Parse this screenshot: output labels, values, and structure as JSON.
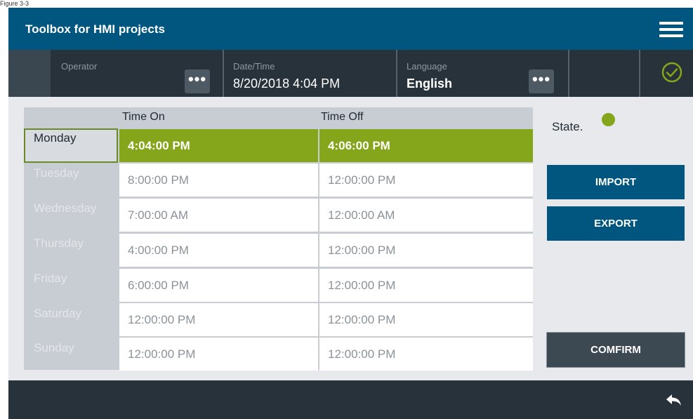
{
  "figure_label": "Figure 3-3",
  "header": {
    "title": "Toolbox for HMI projects",
    "menu_icon": "hamburger-menu-icon"
  },
  "infobar": {
    "operator_label": "Operator",
    "datetime_label": "Date/Time",
    "datetime_value": "8/20/2018 4:04 PM",
    "language_label": "Language",
    "language_value": "English",
    "dots_glyph": "•••",
    "status_icon": "check-circle-icon",
    "status_color": "#85a51b"
  },
  "table": {
    "headers": {
      "time_on": "Time On",
      "time_off": "Time Off"
    },
    "rows": [
      {
        "day": "Monday",
        "on": "4:04:00 PM",
        "off": "4:06:00 PM",
        "selected": true
      },
      {
        "day": "Tuesday",
        "on": "8:00:00 PM",
        "off": "12:00:00 PM"
      },
      {
        "day": "Wednesday",
        "on": "7:00:00 AM",
        "off": "12:00:00 AM"
      },
      {
        "day": "Thursday",
        "on": "4:00:00 PM",
        "off": "12:00:00 PM"
      },
      {
        "day": "Friday",
        "on": "6:00:00 PM",
        "off": "12:00:00 PM"
      },
      {
        "day": "Saturday",
        "on": "12:00:00 PM",
        "off": "12:00:00 PM"
      },
      {
        "day": "Sunday",
        "on": "12:00:00 PM",
        "off": "12:00:00 PM"
      }
    ]
  },
  "state": {
    "label": "State.",
    "color": "#85a51b"
  },
  "buttons": {
    "import": "IMPORT",
    "export": "EXPORT",
    "confirm": "COMFIRM"
  },
  "footer": {
    "back_icon": "back-arrow-icon"
  },
  "colors": {
    "primary": "#00567e",
    "dark": "#28323a",
    "accent_green": "#85a51b"
  }
}
